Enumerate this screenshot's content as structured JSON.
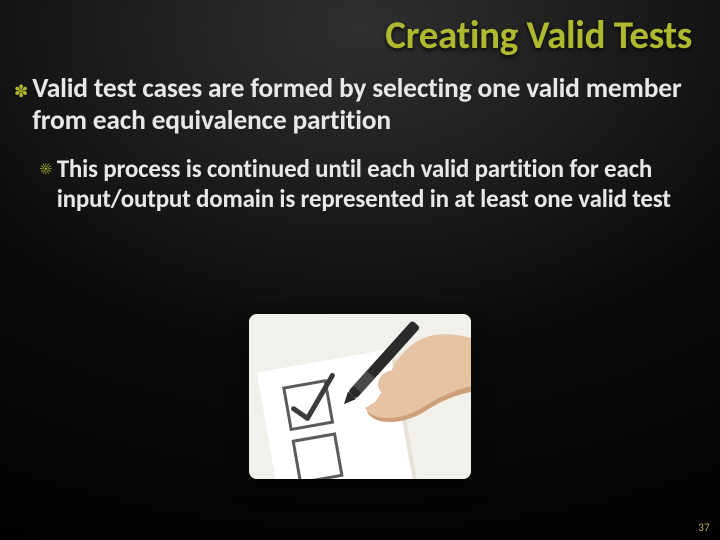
{
  "title": "Creating Valid Tests",
  "bullets": {
    "level1": "Valid test cases are formed by selecting one valid member from each equivalence partition",
    "level2": "This process is continued until each valid partition for each input/output domain is represented in at least one valid test"
  },
  "icons": {
    "flower": "✽",
    "sun": "☀"
  },
  "image": {
    "hand_skin": "#e5c3a3",
    "hand_shadow": "#cda07a",
    "pen_body": "#2a2a2a",
    "pen_grip": "#4a4a4a",
    "paper": "#ffffff",
    "paper_shadow": "#e6e2d7",
    "box_stroke": "#5b5b5b",
    "check_stroke": "#3b3b3b",
    "bg": "#f2f0ea"
  },
  "page_number": "37"
}
